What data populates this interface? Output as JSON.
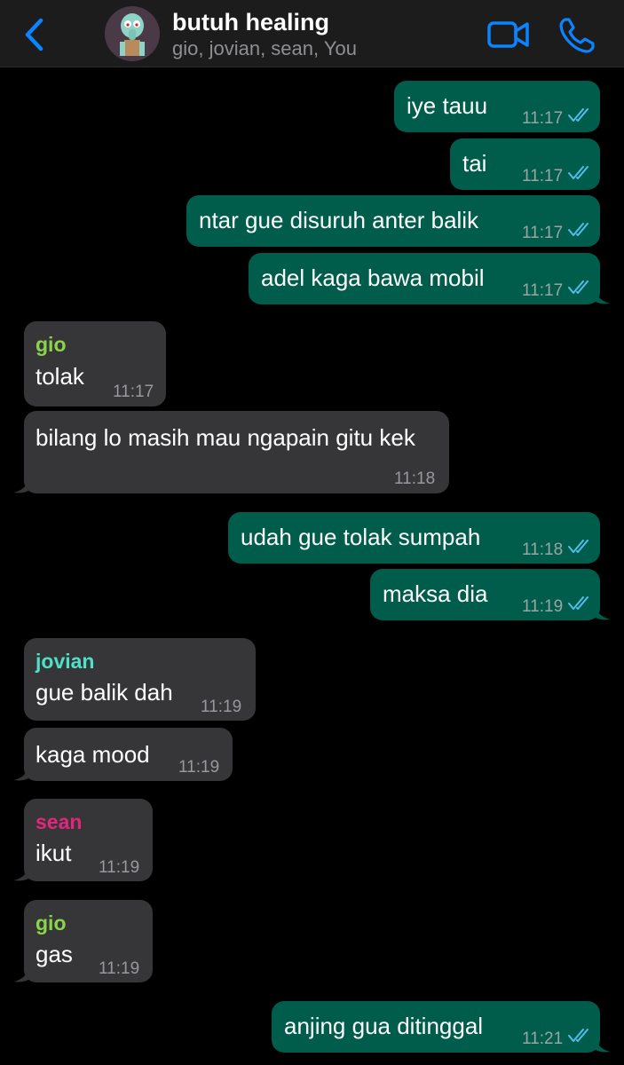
{
  "header": {
    "title": "butuh healing",
    "members": "gio, jovian, sean, You"
  },
  "colors": {
    "accent": "#0a84ff",
    "outgoing_bubble": "#005c4b",
    "incoming_bubble": "#363638",
    "read_ticks": "#53bdeb",
    "gio": "#8bd44a",
    "jovian": "#4fe0c9",
    "sean": "#e0287a"
  },
  "messages": [
    {
      "dir": "out",
      "text": "iye tauu",
      "time": "11:17",
      "status": "read"
    },
    {
      "dir": "out",
      "text": "tai",
      "time": "11:17",
      "status": "read"
    },
    {
      "dir": "out",
      "text": "ntar gue disuruh anter balik",
      "time": "11:17",
      "status": "read"
    },
    {
      "dir": "out",
      "text": "adel kaga bawa mobil",
      "time": "11:17",
      "status": "read"
    },
    {
      "dir": "in",
      "sender": "gio",
      "text": "tolak",
      "time": "11:17"
    },
    {
      "dir": "in",
      "text": "bilang lo masih mau ngapain gitu kek",
      "time": "11:18"
    },
    {
      "dir": "out",
      "text": "udah gue tolak sumpah",
      "time": "11:18",
      "status": "read"
    },
    {
      "dir": "out",
      "text": "maksa dia",
      "time": "11:19",
      "status": "read"
    },
    {
      "dir": "in",
      "sender": "jovian",
      "text": "gue balik dah",
      "time": "11:19"
    },
    {
      "dir": "in",
      "text": "kaga mood",
      "time": "11:19"
    },
    {
      "dir": "in",
      "sender": "sean",
      "text": "ikut",
      "time": "11:19"
    },
    {
      "dir": "in",
      "sender": "gio",
      "text": "gas",
      "time": "11:19"
    },
    {
      "dir": "out",
      "text": "anjing gua ditinggal",
      "time": "11:21",
      "status": "read"
    }
  ]
}
